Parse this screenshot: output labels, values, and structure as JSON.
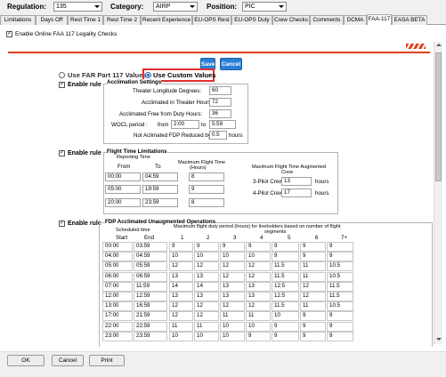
{
  "topbar": {
    "regulation_label": "Regulation:",
    "regulation_value": "135",
    "category_label": "Category:",
    "category_value": "AIRP",
    "position_label": "Position:",
    "position_value": "PIC"
  },
  "tabs": [
    "Limitations",
    "Days Off",
    "Rest Time 1",
    "Rest Time 2",
    "Recent Experience",
    "EU-OPS Rest",
    "EU-OPS Duty",
    "Crew Checks",
    "Comments",
    "DCMA",
    "FAA-117",
    "EASA BETA"
  ],
  "enable_online": "Enable Online FAA 117 Legality Checks",
  "buttons": {
    "save": "Save",
    "cancel": "Cancel",
    "ok": "OK",
    "footer_cancel": "Cancel",
    "print": "Print"
  },
  "radios": {
    "far": "Use FAR Part 117 Values",
    "custom": "Use Custom Values"
  },
  "enable_rule": "Enable rule",
  "acclimation": {
    "title": "Acclimation Settings",
    "theater_label": "Theater Longitude Degrees:",
    "theater_value": "60",
    "acclimated_label": "Acclimated in Theater Hours:",
    "acclimated_value": "72",
    "free_label": "Acclimated Free from Duty Hours:",
    "free_value": "36",
    "wocl_label": "WOCL period :",
    "from_label": "from",
    "from_value": "2:00",
    "to_label": "to",
    "to_value": "5:59",
    "notacc_label": "Not Aclimated FDP Reduced by:",
    "notacc_value": "0.5",
    "hours": "hours"
  },
  "flight_time": {
    "title": "Flight Time Limitations",
    "reporting": "Reporting Time",
    "from": "From",
    "to": "To",
    "max_ft": "Maximum Flight Time",
    "hours_paren": "(Hours)",
    "max_aug": "Maximum Flight Time Augmented",
    "crew": "Crew",
    "rows": [
      {
        "from": "00:00",
        "to": "04:59",
        "max": "8"
      },
      {
        "from": "05:00",
        "to": "19:59",
        "max": "9"
      },
      {
        "from": "20:00",
        "to": "23:59",
        "max": "8"
      }
    ],
    "pilot3_label": "3-Pilot Crew:",
    "pilot3_value": "13",
    "pilot4_label": "4-Pilot Crew:",
    "pilot4_value": "17",
    "hours": "hours"
  },
  "fdp": {
    "title": "FDP Acclimated Unaugmented Operations",
    "scheduled": "Scheduled time",
    "max_desc": "Maximum flight duty period (hours) for lineholders based on number of flight",
    "segments": "segments",
    "start": "Start",
    "end": "End",
    "cols": [
      "1",
      "2",
      "3",
      "4",
      "5",
      "6",
      "7+"
    ],
    "rows": [
      [
        "00:00",
        "03:59",
        "9",
        "9",
        "9",
        "9",
        "9",
        "9",
        "9"
      ],
      [
        "04:00",
        "04:59",
        "10",
        "10",
        "10",
        "10",
        "9",
        "9",
        "9"
      ],
      [
        "05:00",
        "05:59",
        "12",
        "12",
        "12",
        "12",
        "11.5",
        "11",
        "10.5"
      ],
      [
        "06:00",
        "06:59",
        "13",
        "13",
        "12",
        "12",
        "11.5",
        "11",
        "10.5"
      ],
      [
        "07:00",
        "11:59",
        "14",
        "14",
        "13",
        "13",
        "12.5",
        "12",
        "11.5"
      ],
      [
        "12:00",
        "12:59",
        "13",
        "13",
        "13",
        "13",
        "12.5",
        "12",
        "11.5"
      ],
      [
        "13:00",
        "16:59",
        "12",
        "12",
        "12",
        "12",
        "11.5",
        "11",
        "10.5"
      ],
      [
        "17:00",
        "21:59",
        "12",
        "12",
        "11",
        "11",
        "10",
        "9",
        "9"
      ],
      [
        "22:00",
        "22:59",
        "11",
        "11",
        "10",
        "10",
        "9",
        "9",
        "9"
      ],
      [
        "23:00",
        "23:59",
        "10",
        "10",
        "10",
        "9",
        "9",
        "9",
        "9"
      ]
    ]
  }
}
